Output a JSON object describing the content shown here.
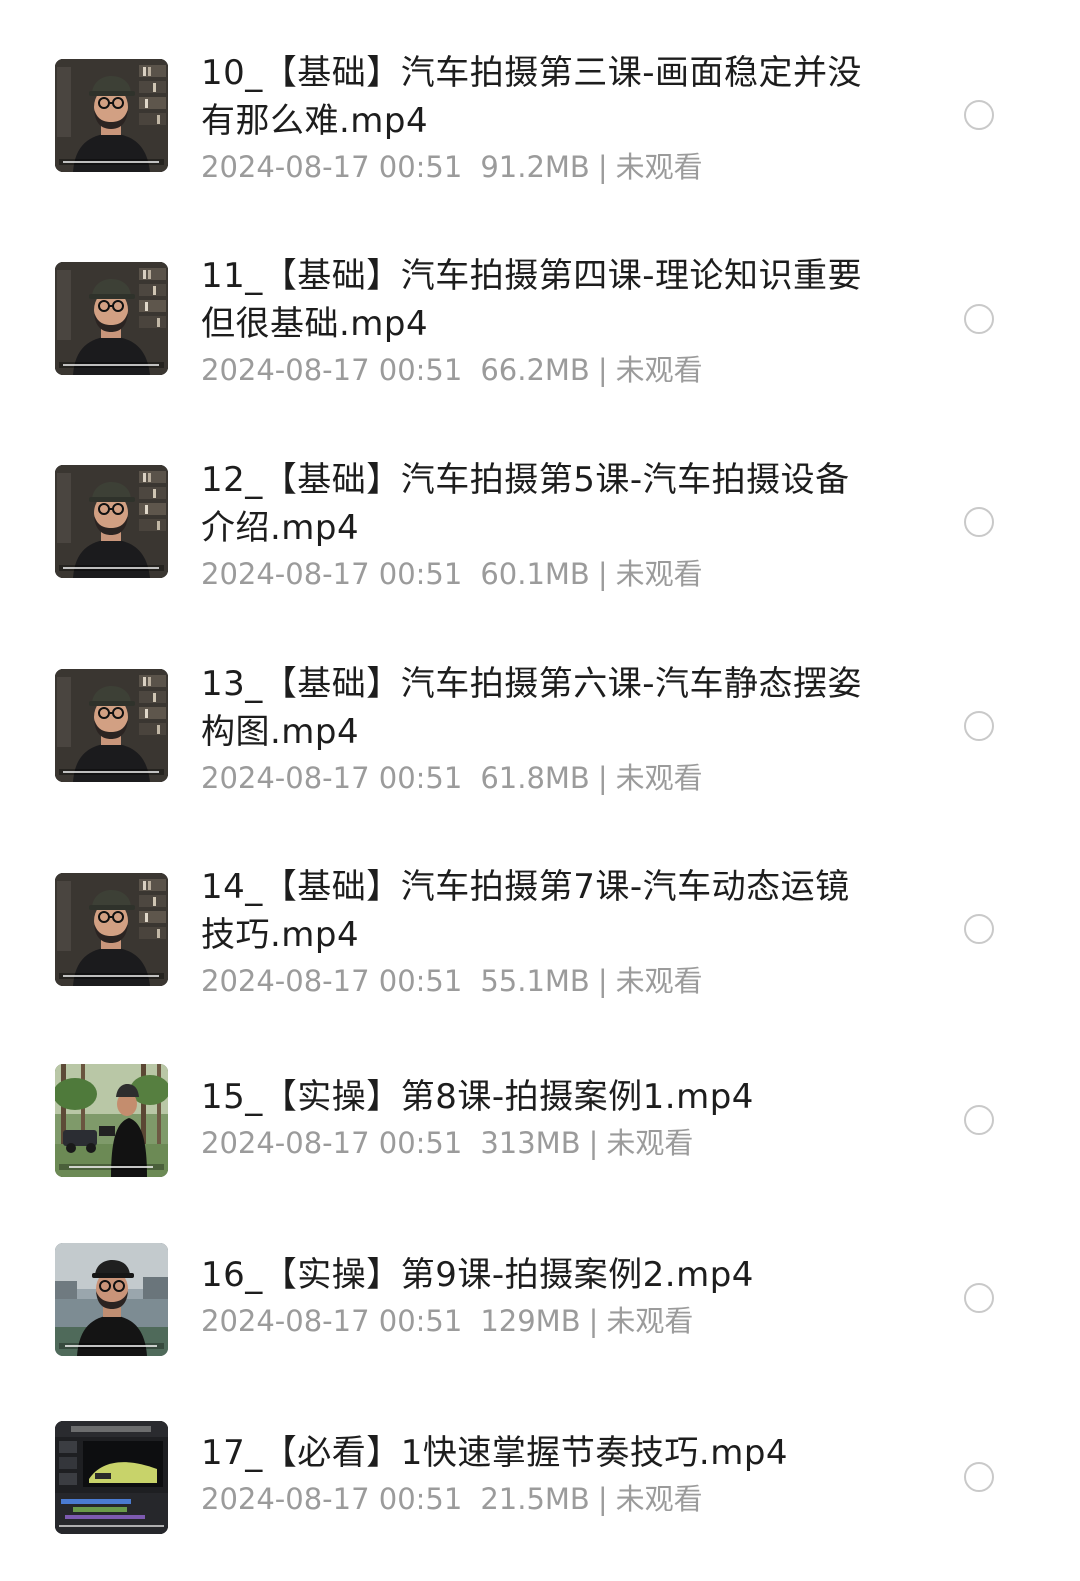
{
  "files": [
    {
      "title": "10_【基础】汽车拍摄第三课-画面稳定并没有那么难.mp4",
      "date": "2024-08-17 00:51",
      "size": "91.2MB",
      "separator": "|",
      "status": "未观看",
      "thumb_icon": "presenter-thumbnail"
    },
    {
      "title": "11_【基础】汽车拍摄第四课-理论知识重要但很基础.mp4",
      "date": "2024-08-17 00:51",
      "size": "66.2MB",
      "separator": "|",
      "status": "未观看",
      "thumb_icon": "presenter-thumbnail"
    },
    {
      "title": "12_【基础】汽车拍摄第5课-汽车拍摄设备介绍.mp4",
      "date": "2024-08-17 00:51",
      "size": "60.1MB",
      "separator": "|",
      "status": "未观看",
      "thumb_icon": "presenter-thumbnail"
    },
    {
      "title": "13_【基础】汽车拍摄第六课-汽车静态摆姿构图.mp4",
      "date": "2024-08-17 00:51",
      "size": "61.8MB",
      "separator": "|",
      "status": "未观看",
      "thumb_icon": "presenter-thumbnail"
    },
    {
      "title": "14_【基础】汽车拍摄第7课-汽车动态运镜技巧.mp4",
      "date": "2024-08-17 00:51",
      "size": "55.1MB",
      "separator": "|",
      "status": "未观看",
      "thumb_icon": "presenter-thumbnail"
    },
    {
      "title": "15_【实操】第8课-拍摄案例1.mp4",
      "date": "2024-08-17 00:51",
      "size": "313MB",
      "separator": "|",
      "status": "未观看",
      "thumb_icon": "outdoor-thumbnail"
    },
    {
      "title": "16_【实操】第9课-拍摄案例2.mp4",
      "date": "2024-08-17 00:51",
      "size": "129MB",
      "separator": "|",
      "status": "未观看",
      "thumb_icon": "waterfront-thumbnail"
    },
    {
      "title": "17_【必看】1快速掌握节奏技巧.mp4",
      "date": "2024-08-17 00:51",
      "size": "21.5MB",
      "separator": "|",
      "status": "未观看",
      "thumb_icon": "editor-thumbnail"
    }
  ],
  "colors": {
    "title": "#1d1d1d",
    "meta": "#9b9b9b",
    "radio_border": "#c9c9c9",
    "background": "#ffffff"
  }
}
